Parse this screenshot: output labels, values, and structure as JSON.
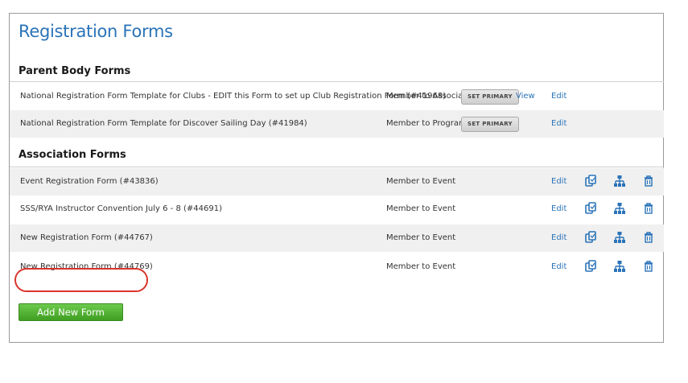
{
  "title": "Registration Forms",
  "sections": {
    "parent": {
      "heading": "Parent Body Forms",
      "rows": [
        {
          "name": "National Registration Form Template for Clubs - EDIT this Form to set up Club Registration Form (#41968)",
          "type": "Member to Association",
          "primary": "SET PRIMARY",
          "view": "View",
          "edit": "Edit"
        },
        {
          "name": "National Registration Form Template for Discover Sailing Day (#41984)",
          "type": "Member to Program",
          "primary": "SET PRIMARY",
          "edit": "Edit"
        }
      ]
    },
    "association": {
      "heading": "Association Forms",
      "rows": [
        {
          "name": "Event Registration Form (#43836)",
          "type": "Member to Event",
          "edit": "Edit"
        },
        {
          "name": "SSS/RYA Instructor Convention July 6 - 8 (#44691)",
          "type": "Member to Event",
          "edit": "Edit"
        },
        {
          "name": "New Registration Form (#44767)",
          "type": "Member to Event",
          "edit": "Edit"
        },
        {
          "name": "New Registration Form (#44769)",
          "type": "Member to Event",
          "edit": "Edit"
        }
      ]
    }
  },
  "add_button": "Add New Form",
  "colors": {
    "link": "#2a73b8",
    "highlight": "#d9342b",
    "add_button": "#4fb02f"
  },
  "icons": [
    "copy-icon",
    "hierarchy-icon",
    "trash-icon"
  ]
}
